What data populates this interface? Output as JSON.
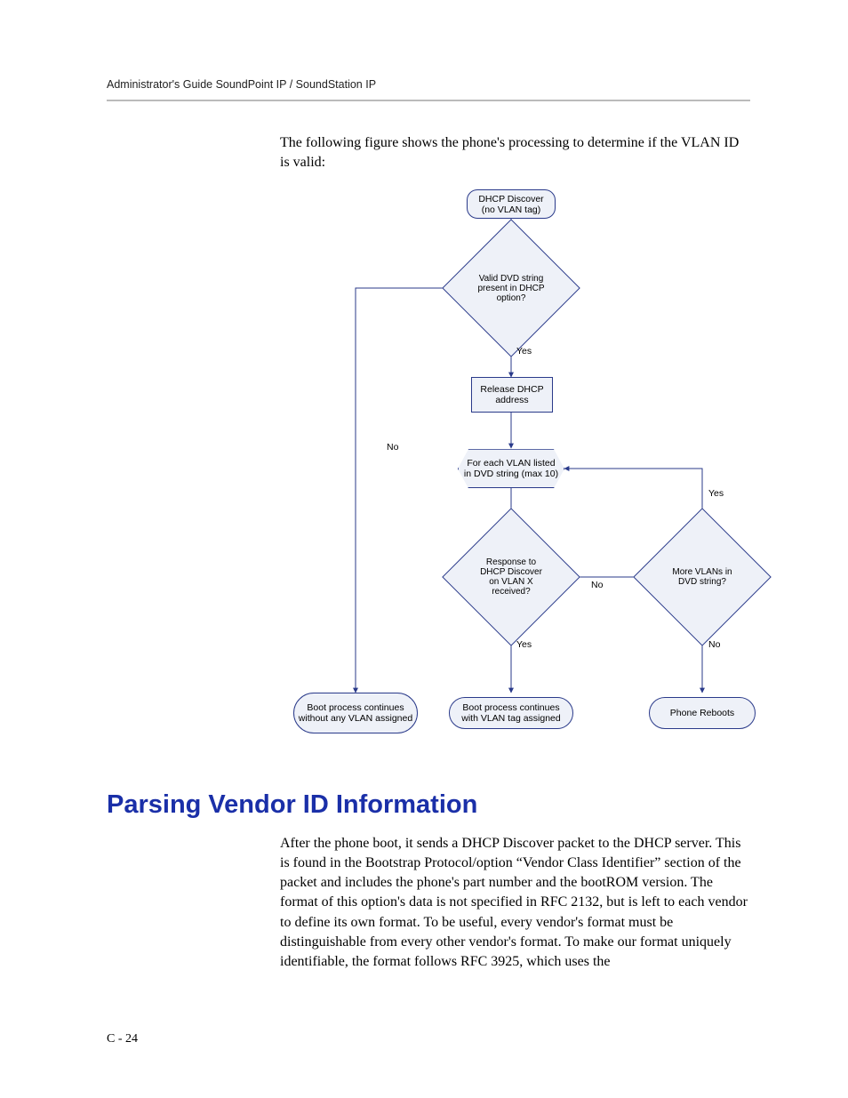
{
  "header": "Administrator's Guide SoundPoint IP / SoundStation IP",
  "intro": "The following figure shows the phone's processing to determine if the VLAN ID is valid:",
  "flowchart": {
    "start": "DHCP Discover\n(no VLAN tag)",
    "d1": "Valid DVD string present in DHCP option?",
    "p1": "Release DHCP address",
    "loop": "For each VLAN listed in DVD string (max 10)",
    "d2": "Response to DHCP Discover on VLAN X received?",
    "d3": "More VLANs in DVD string?",
    "t1": "Boot process continues without any VLAN assigned",
    "t2": "Boot process continues with VLAN tag assigned",
    "t3": "Phone Reboots",
    "yes": "Yes",
    "no": "No"
  },
  "section_title": "Parsing Vendor ID Information",
  "body": "After the phone boot, it sends a DHCP Discover packet to the DHCP server. This is found in the Bootstrap Protocol/option “Vendor Class Identifier” section of the packet and includes the phone's part number and the bootROM version. The format of this option's data is not specified in RFC 2132, but is left to each vendor to define its own format. To be useful, every vendor's format must be distinguishable from every other vendor's format. To make our format uniquely identifiable, the format follows RFC 3925, which uses the",
  "footer": "C - 24"
}
